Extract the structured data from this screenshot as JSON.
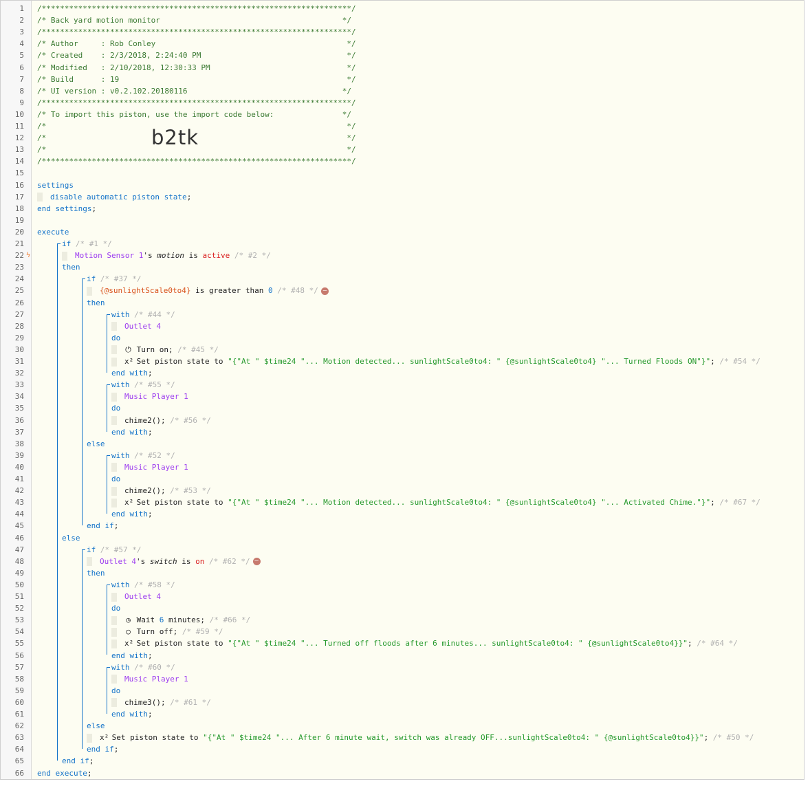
{
  "import_code": "b2tk",
  "lines": [
    {
      "n": "1",
      "ind": 0,
      "flag": "",
      "parts": [
        [
          "hdr",
          "/********************************************************************/"
        ]
      ]
    },
    {
      "n": "2",
      "ind": 0,
      "flag": "",
      "parts": [
        [
          "hdr",
          "/* Back yard motion monitor                                        */"
        ]
      ]
    },
    {
      "n": "3",
      "ind": 0,
      "flag": "",
      "parts": [
        [
          "hdr",
          "/********************************************************************/"
        ]
      ]
    },
    {
      "n": "4",
      "ind": 0,
      "flag": "",
      "parts": [
        [
          "hdr",
          "/* Author     : Rob Conley                                          */"
        ]
      ]
    },
    {
      "n": "5",
      "ind": 0,
      "flag": "",
      "parts": [
        [
          "hdr",
          "/* Created    : 2/3/2018, 2:24:40 PM                                */"
        ]
      ]
    },
    {
      "n": "6",
      "ind": 0,
      "flag": "",
      "parts": [
        [
          "hdr",
          "/* Modified   : 2/10/2018, 12:30:33 PM                              */"
        ]
      ]
    },
    {
      "n": "7",
      "ind": 0,
      "flag": "",
      "parts": [
        [
          "hdr",
          "/* Build      : 19                                                  */"
        ]
      ]
    },
    {
      "n": "8",
      "ind": 0,
      "flag": "",
      "parts": [
        [
          "hdr",
          "/* UI version : v0.2.102.20180116                                  */"
        ]
      ]
    },
    {
      "n": "9",
      "ind": 0,
      "flag": "",
      "parts": [
        [
          "hdr",
          "/********************************************************************/"
        ]
      ]
    },
    {
      "n": "10",
      "ind": 0,
      "flag": "",
      "parts": [
        [
          "hdr",
          "/* To import this piston, use the import code below:               */"
        ]
      ]
    },
    {
      "n": "11",
      "ind": 0,
      "flag": "",
      "parts": [
        [
          "hdr",
          "/*                                                                  */"
        ]
      ]
    },
    {
      "n": "12",
      "ind": 0,
      "flag": "",
      "parts": [
        [
          "hdr",
          "/*                                                                  */"
        ]
      ]
    },
    {
      "n": "13",
      "ind": 0,
      "flag": "",
      "parts": [
        [
          "hdr",
          "/*                                                                  */"
        ]
      ]
    },
    {
      "n": "14",
      "ind": 0,
      "flag": "",
      "parts": [
        [
          "hdr",
          "/********************************************************************/"
        ]
      ]
    },
    {
      "n": "15",
      "ind": 0,
      "flag": "",
      "parts": []
    },
    {
      "n": "16",
      "ind": 0,
      "flag": "",
      "parts": [
        [
          "kw",
          "settings"
        ]
      ]
    },
    {
      "n": "17",
      "ind": 0,
      "flag": "",
      "ghost": true,
      "parts": [
        [
          "kw",
          "disable automatic piston state"
        ],
        [
          "act",
          ";"
        ]
      ]
    },
    {
      "n": "18",
      "ind": 0,
      "flag": "",
      "parts": [
        [
          "kw",
          "end settings"
        ],
        [
          "act",
          ";"
        ]
      ]
    },
    {
      "n": "19",
      "ind": 0,
      "flag": "",
      "parts": []
    },
    {
      "n": "20",
      "ind": 0,
      "flag": "",
      "parts": [
        [
          "kw",
          "execute"
        ]
      ]
    },
    {
      "n": "21",
      "ind": 36,
      "flag": "",
      "parts": [
        [
          "kw",
          "if"
        ],
        [
          "cm",
          " /* #1 */"
        ]
      ]
    },
    {
      "n": "22",
      "ind": 36,
      "flag": "ϟ",
      "ghost": true,
      "parts": [
        [
          "dev",
          "Motion Sensor 1"
        ],
        [
          "act",
          "'s "
        ],
        [
          "em",
          "motion"
        ],
        [
          "act",
          " is "
        ],
        [
          "val",
          "active"
        ],
        [
          "cm",
          " /* #2 */"
        ]
      ]
    },
    {
      "n": "23",
      "ind": 36,
      "flag": "",
      "parts": [
        [
          "kw",
          "then"
        ]
      ]
    },
    {
      "n": "24",
      "ind": 72,
      "flag": "",
      "parts": [
        [
          "kw",
          "if"
        ],
        [
          "cm",
          " /* #37 */"
        ]
      ]
    },
    {
      "n": "25",
      "ind": 72,
      "flag": "",
      "ghost": true,
      "rm": true,
      "parts": [
        [
          "var",
          "{@sunlightScale0to4}"
        ],
        [
          "act",
          " is greater than "
        ],
        [
          "num",
          "0"
        ],
        [
          "cm",
          " /* #48 */"
        ]
      ]
    },
    {
      "n": "26",
      "ind": 72,
      "flag": "",
      "parts": [
        [
          "kw",
          "then"
        ]
      ]
    },
    {
      "n": "27",
      "ind": 108,
      "flag": "",
      "parts": [
        [
          "kw",
          "with"
        ],
        [
          "cm",
          " /* #44 */"
        ]
      ]
    },
    {
      "n": "28",
      "ind": 108,
      "flag": "",
      "ghost": true,
      "parts": [
        [
          "dev",
          "Outlet 4"
        ]
      ]
    },
    {
      "n": "29",
      "ind": 108,
      "flag": "",
      "parts": [
        [
          "kw",
          "do"
        ]
      ]
    },
    {
      "n": "30",
      "ind": 108,
      "flag": "",
      "ghost": true,
      "glyph": "⏻",
      "parts": [
        [
          "act",
          "Turn on;"
        ],
        [
          "cm",
          " /* #45 */"
        ]
      ]
    },
    {
      "n": "31",
      "ind": 108,
      "flag": "",
      "ghost": true,
      "glyph": "x²",
      "parts": [
        [
          "act",
          "Set piston state to "
        ],
        [
          "str",
          "\"{\"At \" $time24 \"... Motion detected... sunlightScale0to4: \" {@sunlightScale0to4} \"... Turned Floods ON\"}\""
        ],
        [
          "act",
          ";"
        ],
        [
          "cm",
          " /* #54 */"
        ]
      ]
    },
    {
      "n": "32",
      "ind": 108,
      "flag": "",
      "parts": [
        [
          "kw",
          "end with"
        ],
        [
          "act",
          ";"
        ]
      ]
    },
    {
      "n": "33",
      "ind": 108,
      "flag": "",
      "parts": [
        [
          "kw",
          "with"
        ],
        [
          "cm",
          " /* #55 */"
        ]
      ]
    },
    {
      "n": "34",
      "ind": 108,
      "flag": "",
      "ghost": true,
      "parts": [
        [
          "dev",
          "Music Player 1"
        ]
      ]
    },
    {
      "n": "35",
      "ind": 108,
      "flag": "",
      "parts": [
        [
          "kw",
          "do"
        ]
      ]
    },
    {
      "n": "36",
      "ind": 108,
      "flag": "",
      "ghost": true,
      "parts": [
        [
          "act",
          "chime2();"
        ],
        [
          "cm",
          " /* #56 */"
        ]
      ]
    },
    {
      "n": "37",
      "ind": 108,
      "flag": "",
      "parts": [
        [
          "kw",
          "end with"
        ],
        [
          "act",
          ";"
        ]
      ]
    },
    {
      "n": "38",
      "ind": 72,
      "flag": "",
      "parts": [
        [
          "kw",
          "else"
        ]
      ]
    },
    {
      "n": "39",
      "ind": 108,
      "flag": "",
      "parts": [
        [
          "kw",
          "with"
        ],
        [
          "cm",
          " /* #52 */"
        ]
      ]
    },
    {
      "n": "40",
      "ind": 108,
      "flag": "",
      "ghost": true,
      "parts": [
        [
          "dev",
          "Music Player 1"
        ]
      ]
    },
    {
      "n": "41",
      "ind": 108,
      "flag": "",
      "parts": [
        [
          "kw",
          "do"
        ]
      ]
    },
    {
      "n": "42",
      "ind": 108,
      "flag": "",
      "ghost": true,
      "parts": [
        [
          "act",
          "chime2();"
        ],
        [
          "cm",
          " /* #53 */"
        ]
      ]
    },
    {
      "n": "43",
      "ind": 108,
      "flag": "",
      "ghost": true,
      "glyph": "x²",
      "parts": [
        [
          "act",
          "Set piston state to "
        ],
        [
          "str",
          "\"{\"At \" $time24 \"... Motion detected... sunlightScale0to4: \" {@sunlightScale0to4} \"... Activated Chime.\"}\""
        ],
        [
          "act",
          ";"
        ],
        [
          "cm",
          " /* #67 */"
        ]
      ]
    },
    {
      "n": "44",
      "ind": 108,
      "flag": "",
      "parts": [
        [
          "kw",
          "end with"
        ],
        [
          "act",
          ";"
        ]
      ]
    },
    {
      "n": "45",
      "ind": 72,
      "flag": "",
      "parts": [
        [
          "kw",
          "end if"
        ],
        [
          "act",
          ";"
        ]
      ]
    },
    {
      "n": "46",
      "ind": 36,
      "flag": "",
      "parts": [
        [
          "kw",
          "else"
        ]
      ]
    },
    {
      "n": "47",
      "ind": 72,
      "flag": "",
      "parts": [
        [
          "kw",
          "if"
        ],
        [
          "cm",
          " /* #57 */"
        ]
      ]
    },
    {
      "n": "48",
      "ind": 72,
      "flag": "",
      "ghost": true,
      "rm": true,
      "parts": [
        [
          "dev",
          "Outlet 4"
        ],
        [
          "act",
          "'s "
        ],
        [
          "em",
          "switch"
        ],
        [
          "act",
          " is "
        ],
        [
          "val",
          "on"
        ],
        [
          "cm",
          " /* #62 */"
        ]
      ]
    },
    {
      "n": "49",
      "ind": 72,
      "flag": "",
      "parts": [
        [
          "kw",
          "then"
        ]
      ]
    },
    {
      "n": "50",
      "ind": 108,
      "flag": "",
      "parts": [
        [
          "kw",
          "with"
        ],
        [
          "cm",
          " /* #58 */"
        ]
      ]
    },
    {
      "n": "51",
      "ind": 108,
      "flag": "",
      "ghost": true,
      "parts": [
        [
          "dev",
          "Outlet 4"
        ]
      ]
    },
    {
      "n": "52",
      "ind": 108,
      "flag": "",
      "parts": [
        [
          "kw",
          "do"
        ]
      ]
    },
    {
      "n": "53",
      "ind": 108,
      "flag": "",
      "ghost": true,
      "glyph": "◷",
      "parts": [
        [
          "act",
          "Wait "
        ],
        [
          "num",
          "6"
        ],
        [
          "act",
          " minutes;"
        ],
        [
          "cm",
          " /* #66 */"
        ]
      ]
    },
    {
      "n": "54",
      "ind": 108,
      "flag": "",
      "ghost": true,
      "glyph": "○",
      "parts": [
        [
          "act",
          "Turn off;"
        ],
        [
          "cm",
          " /* #59 */"
        ]
      ]
    },
    {
      "n": "55",
      "ind": 108,
      "flag": "",
      "ghost": true,
      "glyph": "x²",
      "parts": [
        [
          "act",
          "Set piston state to "
        ],
        [
          "str",
          "\"{\"At \" $time24 \"... Turned off floods after 6 minutes... sunlightScale0to4: \" {@sunlightScale0to4}}\""
        ],
        [
          "act",
          ";"
        ],
        [
          "cm",
          " /* #64 */"
        ]
      ]
    },
    {
      "n": "56",
      "ind": 108,
      "flag": "",
      "parts": [
        [
          "kw",
          "end with"
        ],
        [
          "act",
          ";"
        ]
      ]
    },
    {
      "n": "57",
      "ind": 108,
      "flag": "",
      "parts": [
        [
          "kw",
          "with"
        ],
        [
          "cm",
          " /* #60 */"
        ]
      ]
    },
    {
      "n": "58",
      "ind": 108,
      "flag": "",
      "ghost": true,
      "parts": [
        [
          "dev",
          "Music Player 1"
        ]
      ]
    },
    {
      "n": "59",
      "ind": 108,
      "flag": "",
      "parts": [
        [
          "kw",
          "do"
        ]
      ]
    },
    {
      "n": "60",
      "ind": 108,
      "flag": "",
      "ghost": true,
      "parts": [
        [
          "act",
          "chime3();"
        ],
        [
          "cm",
          " /* #61 */"
        ]
      ]
    },
    {
      "n": "61",
      "ind": 108,
      "flag": "",
      "parts": [
        [
          "kw",
          "end with"
        ],
        [
          "act",
          ";"
        ]
      ]
    },
    {
      "n": "62",
      "ind": 72,
      "flag": "",
      "parts": [
        [
          "kw",
          "else"
        ]
      ]
    },
    {
      "n": "63",
      "ind": 72,
      "flag": "",
      "ghost": true,
      "glyph": "x²",
      "parts": [
        [
          "act",
          "Set piston state to "
        ],
        [
          "str",
          "\"{\"At \" $time24 \"... After 6 minute wait, switch was already OFF...sunlightScale0to4: \" {@sunlightScale0to4}}\""
        ],
        [
          "act",
          ";"
        ],
        [
          "cm",
          " /* #50 */"
        ]
      ]
    },
    {
      "n": "64",
      "ind": 72,
      "flag": "",
      "parts": [
        [
          "kw",
          "end if"
        ],
        [
          "act",
          ";"
        ]
      ]
    },
    {
      "n": "65",
      "ind": 36,
      "flag": "",
      "parts": [
        [
          "kw",
          "end if"
        ],
        [
          "act",
          ";"
        ]
      ]
    },
    {
      "n": "66",
      "ind": 0,
      "flag": "",
      "parts": [
        [
          "kw",
          "end execute"
        ],
        [
          "act",
          ";"
        ]
      ]
    }
  ]
}
